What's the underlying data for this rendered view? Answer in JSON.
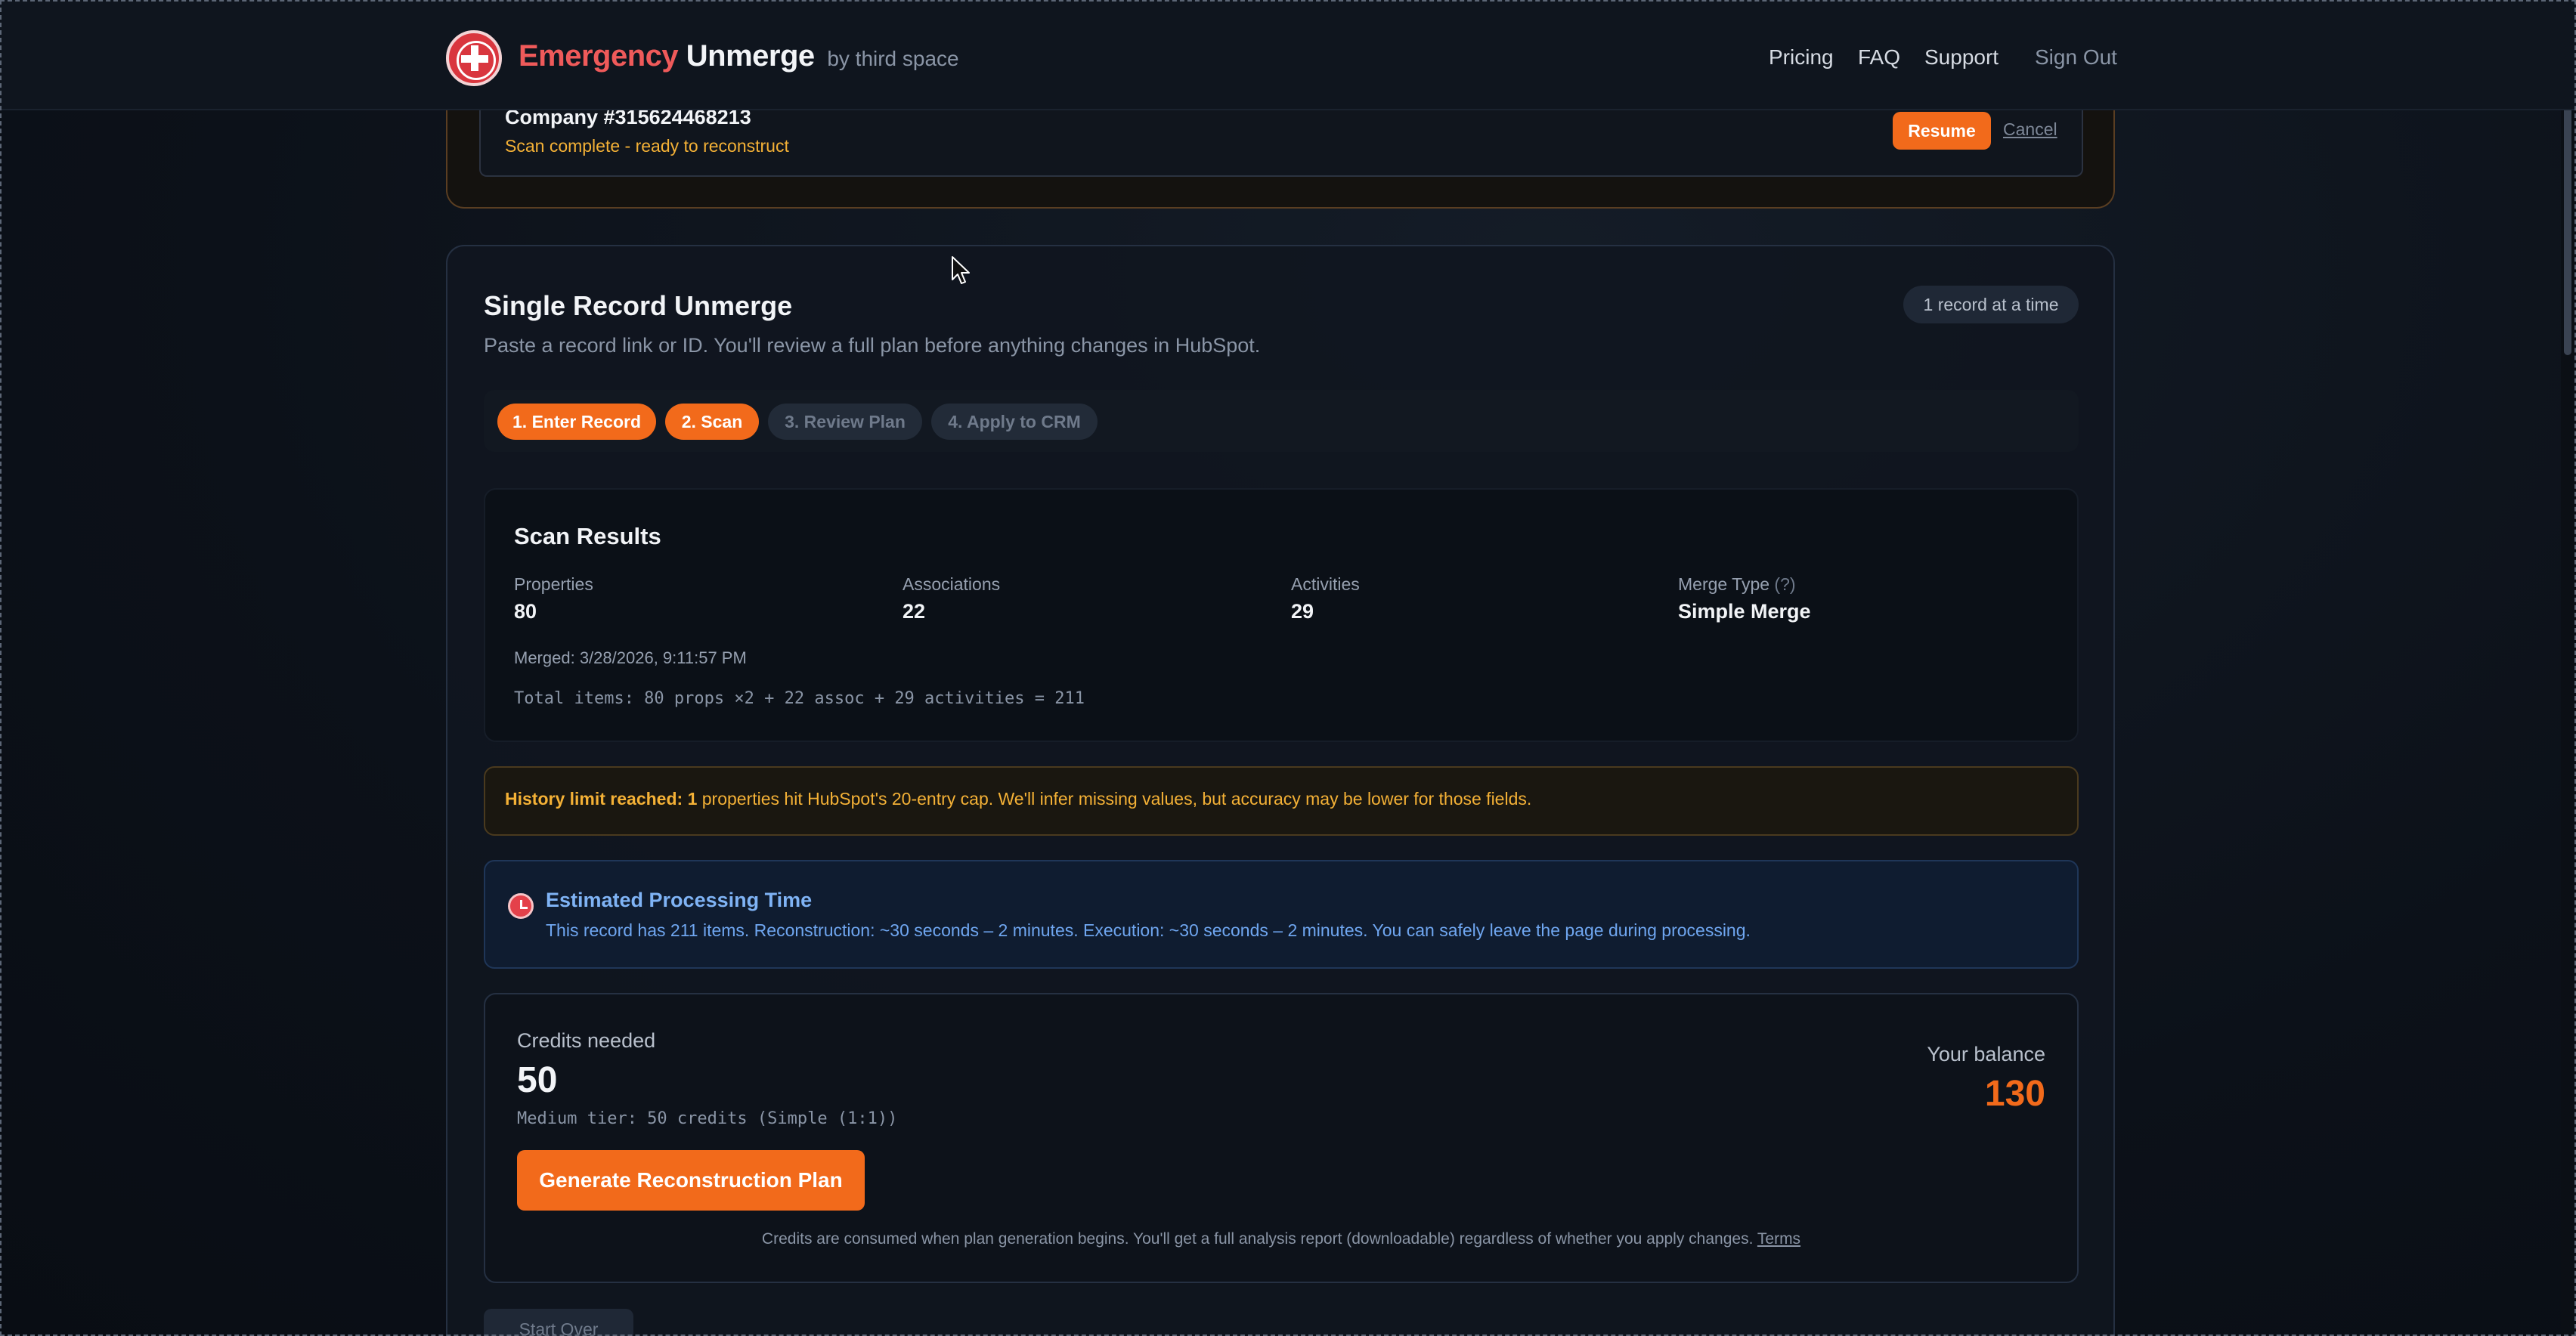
{
  "header": {
    "brand_part1": "Emergency",
    "brand_part2": "Unmerge",
    "brand_byline": "by third space",
    "nav": [
      "Pricing",
      "FAQ",
      "Support"
    ],
    "sign_out": "Sign Out"
  },
  "pending": {
    "company": "Company #315624468213",
    "status": "Scan complete - ready to reconstruct",
    "resume_label": "Resume",
    "cancel_label": "Cancel"
  },
  "main": {
    "title": "Single Record Unmerge",
    "subtitle": "Paste a record link or ID. You'll review a full plan before anything changes in HubSpot.",
    "badge": "1 record at a time",
    "steps": [
      "1. Enter Record",
      "2. Scan",
      "3. Review Plan",
      "4. Apply to CRM"
    ]
  },
  "scan": {
    "title": "Scan Results",
    "stats": [
      {
        "label": "Properties",
        "value": "80"
      },
      {
        "label": "Associations",
        "value": "22"
      },
      {
        "label": "Activities",
        "value": "29"
      },
      {
        "label": "Merge Type",
        "value": "Simple Merge"
      }
    ],
    "merge_type_help": "(?)",
    "merged": "Merged: 3/28/2026, 9:11:57 PM",
    "total": "Total items: 80 props ×2 + 22 assoc + 29 activities = 211"
  },
  "warning": {
    "bold": "History limit reached: 1",
    "text": " properties hit HubSpot's 20-entry cap. We'll infer missing values, but accuracy may be lower for those fields."
  },
  "estimate": {
    "title": "Estimated Processing Time",
    "body": "This record has 211 items. Reconstruction: ~30 seconds – 2 minutes. Execution: ~30 seconds – 2 minutes. You can safely leave the page during processing."
  },
  "credits": {
    "needed_label": "Credits needed",
    "needed_value": "50",
    "tier": "Medium tier: 50 credits (Simple (1:1))",
    "balance_label": "Your balance",
    "balance_value": "130",
    "generate_label": "Generate Reconstruction Plan",
    "disclaimer": "Credits are consumed when plan generation begins. You'll get a full analysis report (downloadable) regardless of whether you apply changes.",
    "terms": "Terms"
  },
  "start_over_label": "Start Over",
  "colors": {
    "accent": "#f26a1b",
    "brand_red": "#ef5a5a",
    "warning": "#f4b136",
    "info": "#7fb3f5"
  }
}
